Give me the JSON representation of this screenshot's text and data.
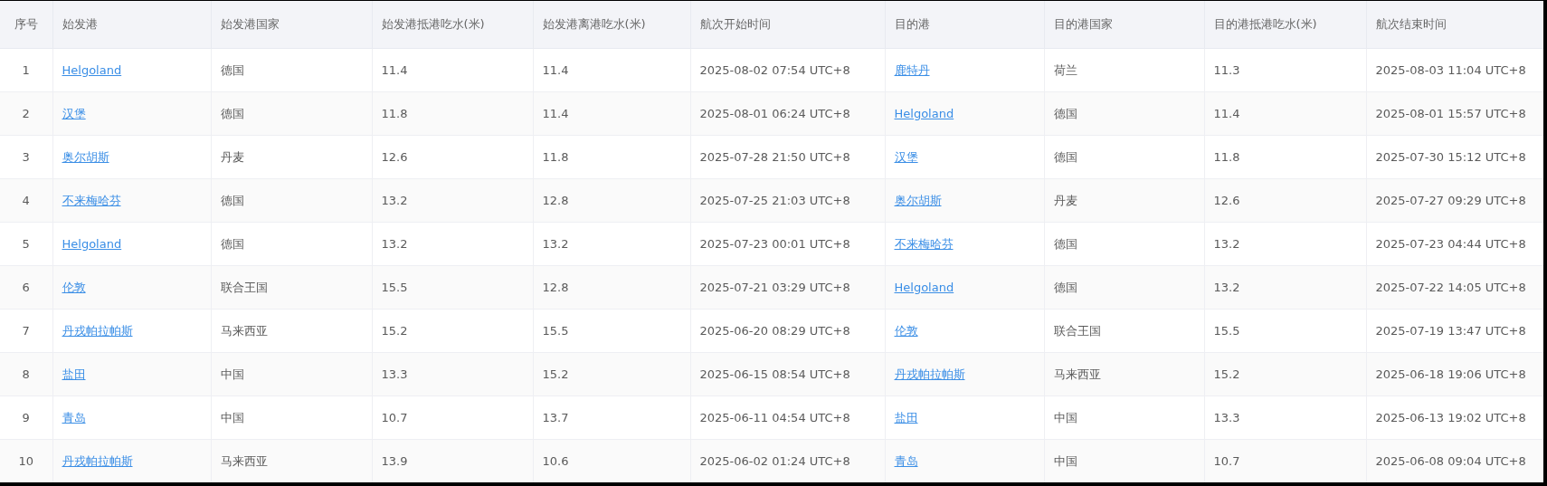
{
  "table": {
    "columns": [
      {
        "label": "序号",
        "kind": "index"
      },
      {
        "label": "始发港",
        "kind": "link"
      },
      {
        "label": "始发港国家",
        "kind": "text"
      },
      {
        "label": "始发港抵港吃水(米)",
        "kind": "text"
      },
      {
        "label": "始发港离港吃水(米)",
        "kind": "text"
      },
      {
        "label": "航次开始时间",
        "kind": "text"
      },
      {
        "label": "目的港",
        "kind": "link"
      },
      {
        "label": "目的港国家",
        "kind": "text"
      },
      {
        "label": "目的港抵港吃水(米)",
        "kind": "text"
      },
      {
        "label": "航次结束时间",
        "kind": "text"
      }
    ],
    "rows": [
      [
        "1",
        "Helgoland",
        "德国",
        "11.4",
        "11.4",
        "2025-08-02 07:54 UTC+8",
        "鹿特丹",
        "荷兰",
        "11.3",
        "2025-08-03 11:04 UTC+8"
      ],
      [
        "2",
        "汉堡",
        "德国",
        "11.8",
        "11.4",
        "2025-08-01 06:24 UTC+8",
        "Helgoland",
        "德国",
        "11.4",
        "2025-08-01 15:57 UTC+8"
      ],
      [
        "3",
        "奥尔胡斯",
        "丹麦",
        "12.6",
        "11.8",
        "2025-07-28 21:50 UTC+8",
        "汉堡",
        "德国",
        "11.8",
        "2025-07-30 15:12 UTC+8"
      ],
      [
        "4",
        "不来梅哈芬",
        "德国",
        "13.2",
        "12.8",
        "2025-07-25 21:03 UTC+8",
        "奥尔胡斯",
        "丹麦",
        "12.6",
        "2025-07-27 09:29 UTC+8"
      ],
      [
        "5",
        "Helgoland",
        "德国",
        "13.2",
        "13.2",
        "2025-07-23 00:01 UTC+8",
        "不来梅哈芬",
        "德国",
        "13.2",
        "2025-07-23 04:44 UTC+8"
      ],
      [
        "6",
        "伦敦",
        "联合王国",
        "15.5",
        "12.8",
        "2025-07-21 03:29 UTC+8",
        "Helgoland",
        "德国",
        "13.2",
        "2025-07-22 14:05 UTC+8"
      ],
      [
        "7",
        "丹戎帕拉帕斯",
        "马来西亚",
        "15.2",
        "15.5",
        "2025-06-20 08:29 UTC+8",
        "伦敦",
        "联合王国",
        "15.5",
        "2025-07-19 13:47 UTC+8"
      ],
      [
        "8",
        "盐田",
        "中国",
        "13.3",
        "15.2",
        "2025-06-15 08:54 UTC+8",
        "丹戎帕拉帕斯",
        "马来西亚",
        "15.2",
        "2025-06-18 19:06 UTC+8"
      ],
      [
        "9",
        "青岛",
        "中国",
        "10.7",
        "13.7",
        "2025-06-11 04:54 UTC+8",
        "盐田",
        "中国",
        "13.3",
        "2025-06-13 19:02 UTC+8"
      ],
      [
        "10",
        "丹戎帕拉帕斯",
        "马来西亚",
        "13.9",
        "10.6",
        "2025-06-02 01:24 UTC+8",
        "青岛",
        "中国",
        "10.7",
        "2025-06-08 09:04 UTC+8"
      ]
    ]
  }
}
